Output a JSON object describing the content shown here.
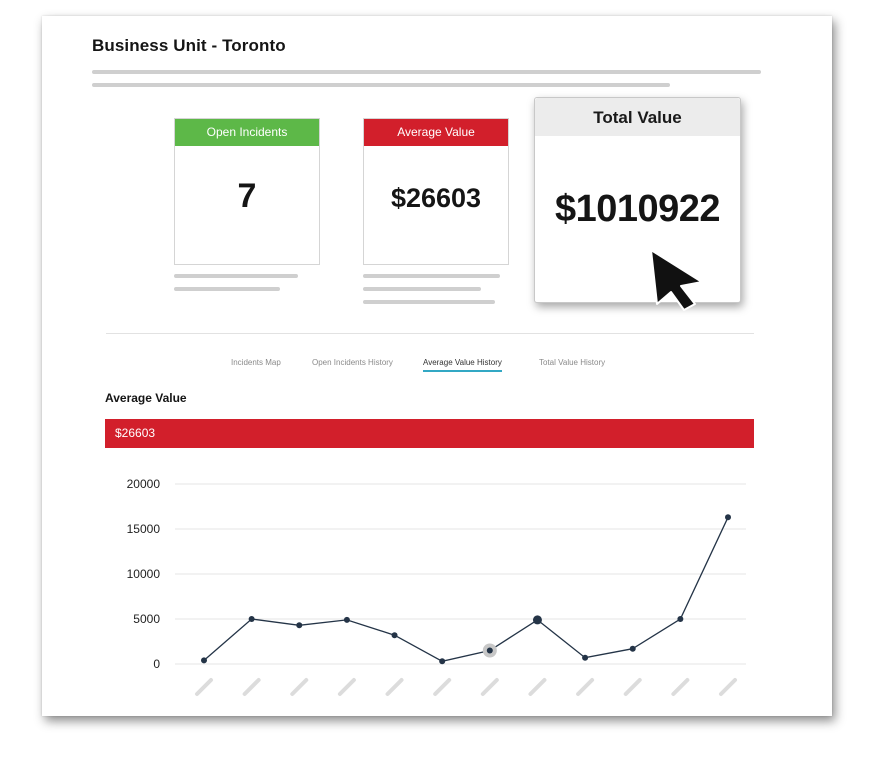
{
  "page": {
    "title": "Business Unit - Toronto"
  },
  "colors": {
    "green": "#5db848",
    "red": "#d21f2b",
    "tab_accent": "#33a8c4"
  },
  "cards": {
    "open_incidents": {
      "label": "Open Incidents",
      "value": "7"
    },
    "average_value": {
      "label": "Average Value",
      "value": "$26603"
    },
    "total_value": {
      "label": "Total Value",
      "value": "$1010922"
    }
  },
  "cursor": {
    "icon": "mouse-pointer-icon"
  },
  "tabs": [
    {
      "label": "Incidents Map",
      "active": false
    },
    {
      "label": "Open Incidents History",
      "active": false
    },
    {
      "label": "Average Value History",
      "active": true
    },
    {
      "label": "Total Value History",
      "active": false
    }
  ],
  "section": {
    "title": "Average Value",
    "banner_value": "$26603"
  },
  "chart_data": {
    "type": "line",
    "title": "",
    "xlabel": "",
    "ylabel": "",
    "x_tick_labels": "placeholder-skeleton",
    "y_ticks": [
      0,
      5000,
      10000,
      15000,
      20000
    ],
    "ylim": [
      0,
      20000
    ],
    "grid": true,
    "values": [
      400,
      5000,
      4300,
      4900,
      3200,
      300,
      1500,
      4900,
      700,
      1700,
      5000,
      16300
    ],
    "highlighted_points": [
      6,
      7
    ]
  }
}
